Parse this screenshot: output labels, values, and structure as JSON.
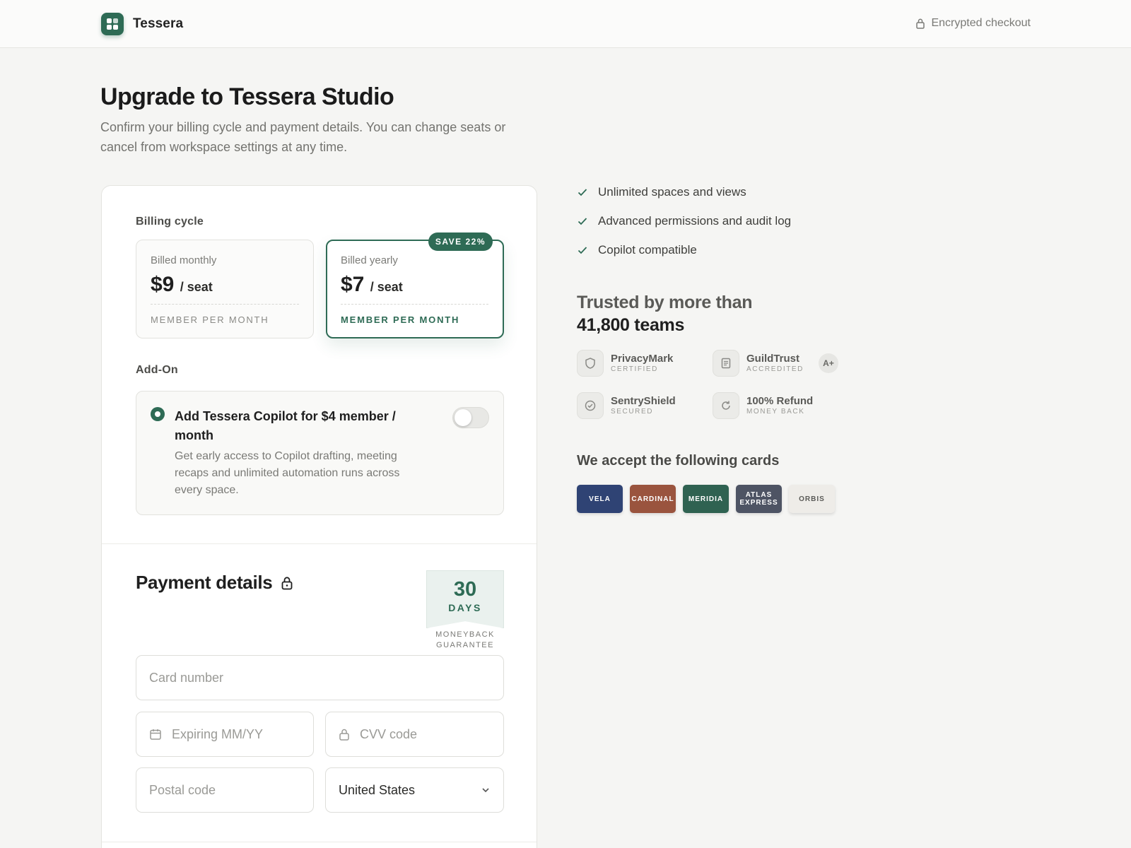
{
  "brand": {
    "name": "Tessera"
  },
  "header": {
    "secure_label": "Encrypted checkout"
  },
  "page": {
    "title": "Upgrade to Tessera Studio",
    "subtitle": "Confirm your billing cycle and payment details. You can change seats or cancel from workspace settings at any time."
  },
  "billing": {
    "label": "Billing cycle",
    "plans": [
      {
        "name": "Billed monthly",
        "price": "$9",
        "per": "/ seat",
        "unit": "MEMBER PER MONTH",
        "selected": false
      },
      {
        "name": "Billed yearly",
        "price": "$7",
        "per": "/ seat",
        "unit": "MEMBER PER MONTH",
        "selected": true,
        "badge": "SAVE 22%"
      }
    ]
  },
  "addon": {
    "label": "Add-On",
    "title": "Add Tessera Copilot for $4 member / month",
    "description": "Get early access to Copilot drafting, meeting recaps and unlimited automation runs across every space.",
    "enabled": false
  },
  "payment": {
    "title": "Payment details",
    "guarantee": {
      "number": "30",
      "unit": "DAYS",
      "text": "MONEYBACK GUARANTEE"
    },
    "fields": {
      "card_placeholder": "Card number",
      "expiry_placeholder": "Expiring MM/YY",
      "cvv_placeholder": "CVV code",
      "postal_placeholder": "Postal code",
      "country_value": "United States"
    }
  },
  "features": [
    "Unlimited spaces and views",
    "Advanced permissions and audit log",
    "Copilot compatible"
  ],
  "trust": {
    "heading_line1": "Trusted by more than",
    "heading_line2": "41,800 teams",
    "badges": [
      {
        "name": "PrivacyMark",
        "sub": "CERTIFIED",
        "icon": "shield-icon"
      },
      {
        "name": "GuildTrust",
        "sub": "ACCREDITED",
        "icon": "document-icon",
        "grade": "A+"
      },
      {
        "name": "SentryShield",
        "sub": "SECURED",
        "icon": "check-circle-icon"
      },
      {
        "name": "100% Refund",
        "sub": "MONEY BACK",
        "icon": "refresh-icon"
      }
    ]
  },
  "accepted_cards": {
    "heading": "We accept the following cards",
    "cards": [
      {
        "name": "VELA",
        "color": "#2f4374",
        "text_color": "#ffffff"
      },
      {
        "name": "CARDINAL",
        "color": "#9a543e",
        "text_color": "#ffffff"
      },
      {
        "name": "MERIDIA",
        "color": "#2f6251",
        "text_color": "#ffffff"
      },
      {
        "name": "ATLAS EXPRESS",
        "color": "#4e5464",
        "text_color": "#ffffff"
      },
      {
        "name": "ORBIS",
        "color": "#eeece8",
        "text_color": "#5a5a57"
      }
    ]
  },
  "colors": {
    "accent": "#2e6b55",
    "background": "#f5f5f3"
  }
}
